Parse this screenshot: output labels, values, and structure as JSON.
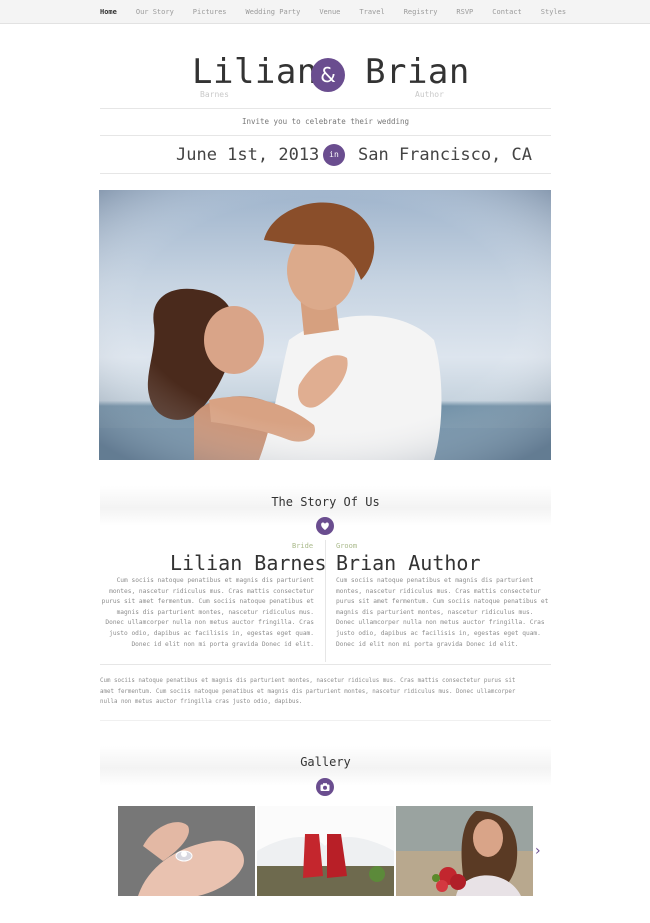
{
  "nav": {
    "items": [
      "Home",
      "Our Story",
      "Pictures",
      "Wedding Party",
      "Venue",
      "Travel",
      "Registry",
      "RSVP",
      "Contact",
      "Styles"
    ],
    "active": "Home"
  },
  "couple": {
    "bride_first": "Lilian",
    "groom_first": "Brian",
    "ampersand": "&",
    "bride_last": "Barnes",
    "groom_last": "Author"
  },
  "invite_text": "Invite you to celebrate their wedding",
  "event": {
    "date": "June 1st, 2013",
    "connector": "in",
    "location": "San Francisco, CA"
  },
  "story": {
    "title": "The Story Of Us",
    "icon": "heart-icon",
    "bride": {
      "role": "Bride",
      "name": "Lilian Barnes",
      "lines": [
        "Cum sociis natoque penatibus et magnis dis parturient",
        "montes, nascetur ridiculus mus. Cras mattis consectetur",
        "purus sit amet fermentum. Cum sociis natoque penatibus et",
        "magnis dis parturient montes, nascetur ridiculus mus.",
        "Donec ullamcorper nulla non metus auctor fringilla. Cras",
        "justo odio, dapibus ac facilisis in, egestas eget quam.",
        "Donec id elit non mi porta gravida Donec id elit."
      ]
    },
    "groom": {
      "role": "Groom",
      "name": "Brian Author",
      "lines": [
        "Cum sociis natoque penatibus et magnis dis parturient",
        "montes, nascetur ridiculus mus. Cras mattis consectetur",
        "purus sit amet fermentum. Cum sociis natoque penatibus et",
        "magnis dis parturient montes, nascetur ridiculus mus.",
        "Donec ullamcorper nulla non metus auctor fringilla. Cras",
        "justo odio, dapibus ac facilisis in, egestas eget quam.",
        "Donec id elit non mi porta gravida Donec id elit."
      ]
    },
    "full_lines": [
      "Cum sociis natoque penatibus et magnis dis parturient montes, nascetur ridiculus mus. Cras mattis consectetur purus sit",
      "amet fermentum. Cum sociis natoque penatibus et magnis dis parturient montes, nascetur ridiculus mus. Donec ullamcorper",
      "nulla non metus auctor fringilla cras justo odio, dapibus."
    ]
  },
  "gallery": {
    "title": "Gallery",
    "icon": "camera-icon",
    "next_icon": "chevron-right-icon",
    "thumbs": [
      "ring-photo",
      "red-shoes-photo",
      "bride-bouquet-photo"
    ]
  },
  "colors": {
    "accent": "#6a4d8f",
    "role_label": "#a9b98a",
    "muted_text": "#8c8c8c"
  }
}
